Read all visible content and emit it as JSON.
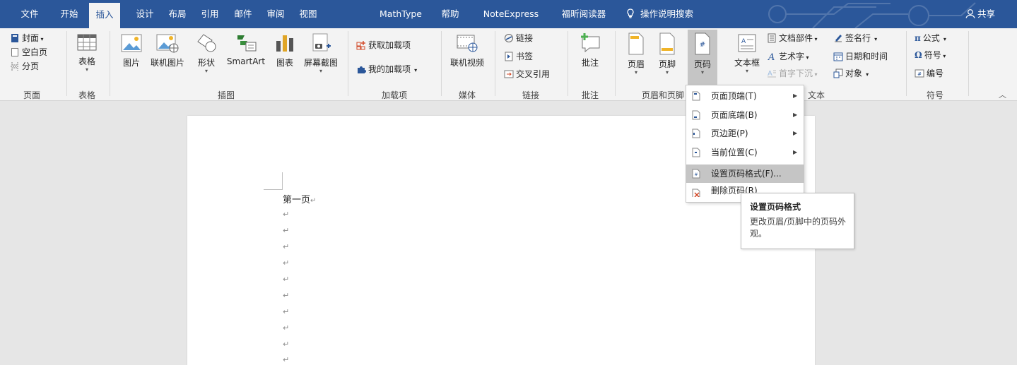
{
  "tabs": [
    "文件",
    "开始",
    "插入",
    "设计",
    "布局",
    "引用",
    "邮件",
    "审阅",
    "视图",
    "MathType",
    "帮助",
    "NoteExpress",
    "福昕阅读器"
  ],
  "active_tab": "插入",
  "search_label": "操作说明搜索",
  "share_label": "共享",
  "colors": {
    "title_bar": "#2b579a",
    "ribbon_bg": "#f3f3f3",
    "doc_bg": "#e6e6e6",
    "highlight": "#c5c5c5",
    "accent_red": "#d24726",
    "accent_green": "#6aa84f",
    "accent_blue": "#2b579a"
  },
  "ribbon": {
    "pages": {
      "cover": "封面",
      "blank": "空白页",
      "break": "分页",
      "group": "页面"
    },
    "tables": {
      "table": "表格",
      "group": "表格"
    },
    "illustrations": {
      "picture": "图片",
      "online_picture": "联机图片",
      "shapes": "形状",
      "smartart": "SmartArt",
      "chart": "图表",
      "screenshot": "屏幕截图",
      "group": "插图"
    },
    "addins": {
      "get": "获取加载项",
      "mine": "我的加载项",
      "group": "加载项"
    },
    "media": {
      "online_video": "联机视频",
      "group": "媒体"
    },
    "links": {
      "link": "链接",
      "bookmark": "书签",
      "cross_ref": "交叉引用",
      "group": "链接"
    },
    "comments": {
      "comment": "批注",
      "group": "批注"
    },
    "header_footer": {
      "header": "页眉",
      "footer": "页脚",
      "page_number": "页码",
      "group": "页眉和页脚"
    },
    "text": {
      "textbox": "文本框",
      "quick_parts": "文档部件",
      "wordart": "艺术字",
      "dropcap": "首字下沉",
      "signature": "签名行",
      "datetime": "日期和时间",
      "object": "对象",
      "group": "文本"
    },
    "symbols": {
      "equation": "公式",
      "symbol": "符号",
      "number": "编号",
      "group": "符号"
    }
  },
  "menu": {
    "items": [
      {
        "label": "页面顶端(T)",
        "submenu": true
      },
      {
        "label": "页面底端(B)",
        "submenu": true
      },
      {
        "label": "页边距(P)",
        "submenu": true
      },
      {
        "label": "当前位置(C)",
        "submenu": true
      },
      {
        "label": "设置页码格式(F)...",
        "submenu": false
      },
      {
        "label": "删除页码(R)",
        "submenu": false
      }
    ]
  },
  "tooltip": {
    "title": "设置页码格式",
    "body": "更改页眉/页脚中的页码外观。"
  },
  "document": {
    "first_line": "第一页",
    "paragraph_mark": "↵"
  }
}
